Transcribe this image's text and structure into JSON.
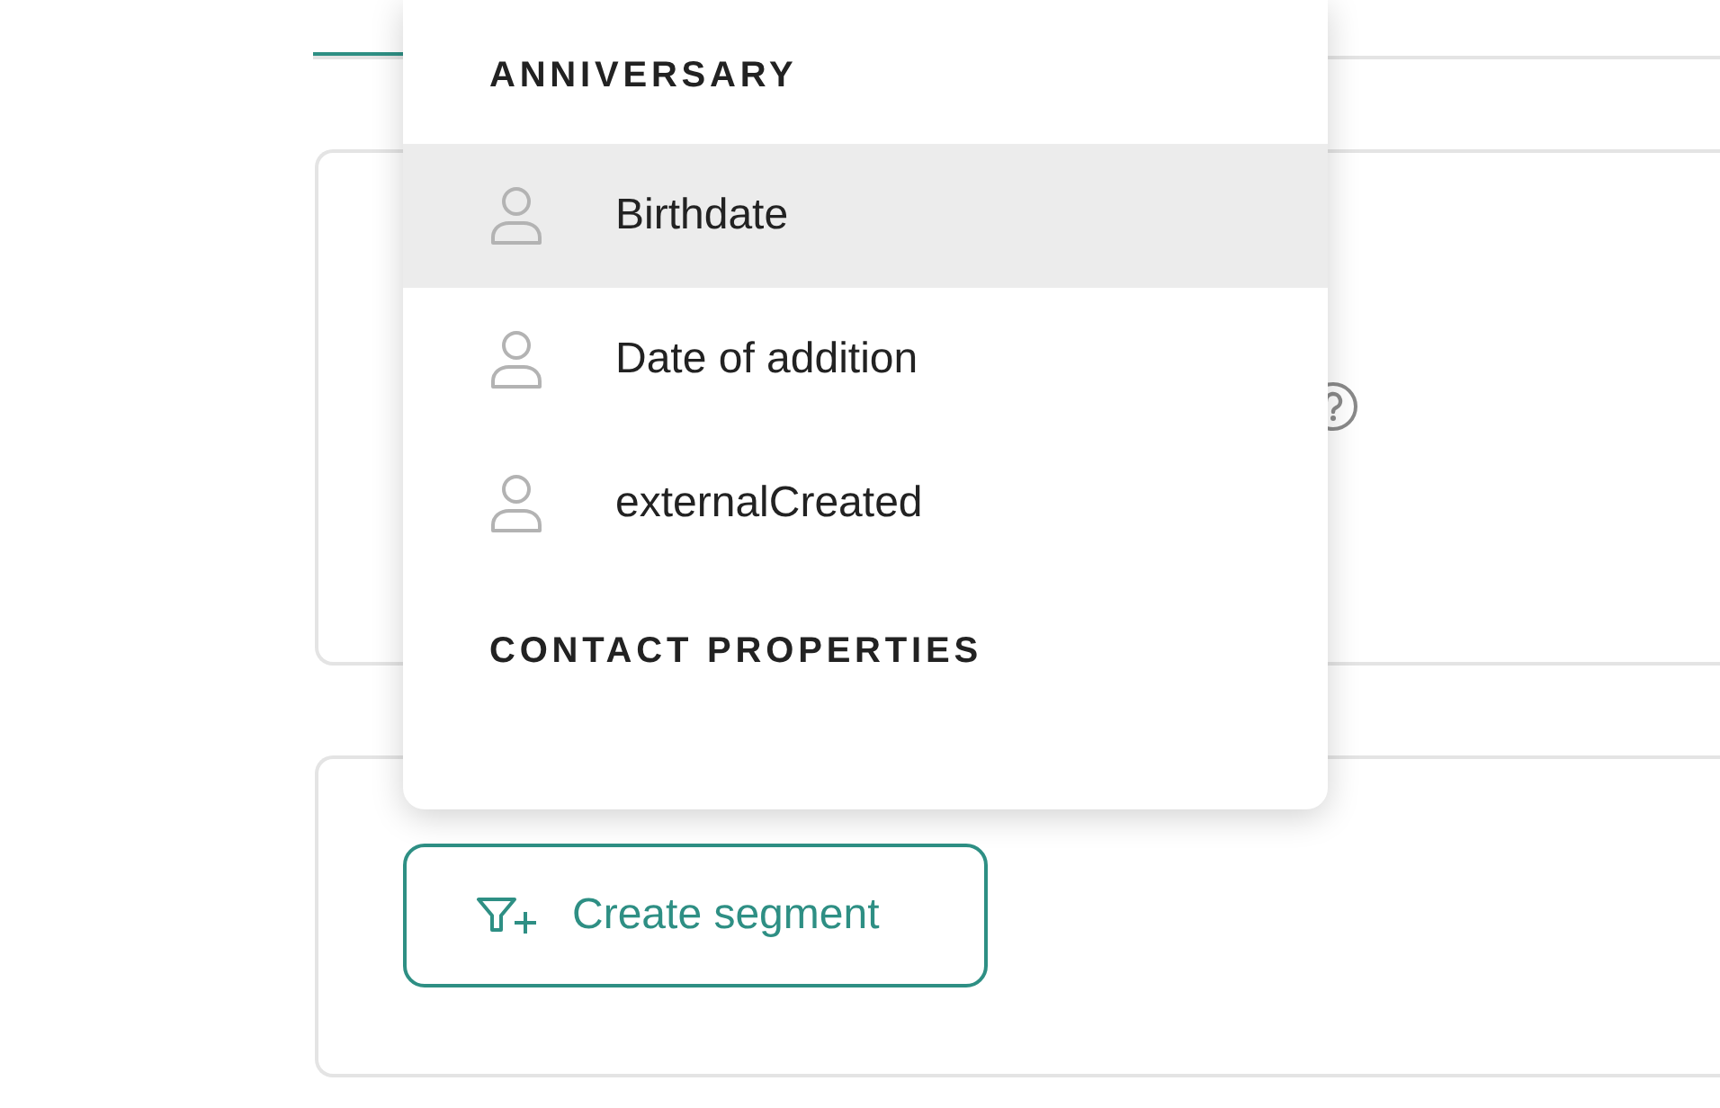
{
  "tabs": [
    {
      "selected": true
    }
  ],
  "dropdown": {
    "groups": [
      {
        "header": "ANNIVERSARY",
        "items": [
          {
            "label": "Birthdate",
            "selected": true
          },
          {
            "label": "Date of addition",
            "selected": false
          },
          {
            "label": "externalCreated",
            "selected": false
          }
        ]
      },
      {
        "header": "CONTACT PROPERTIES"
      }
    ]
  },
  "create_button": {
    "label": "Create segment"
  }
}
